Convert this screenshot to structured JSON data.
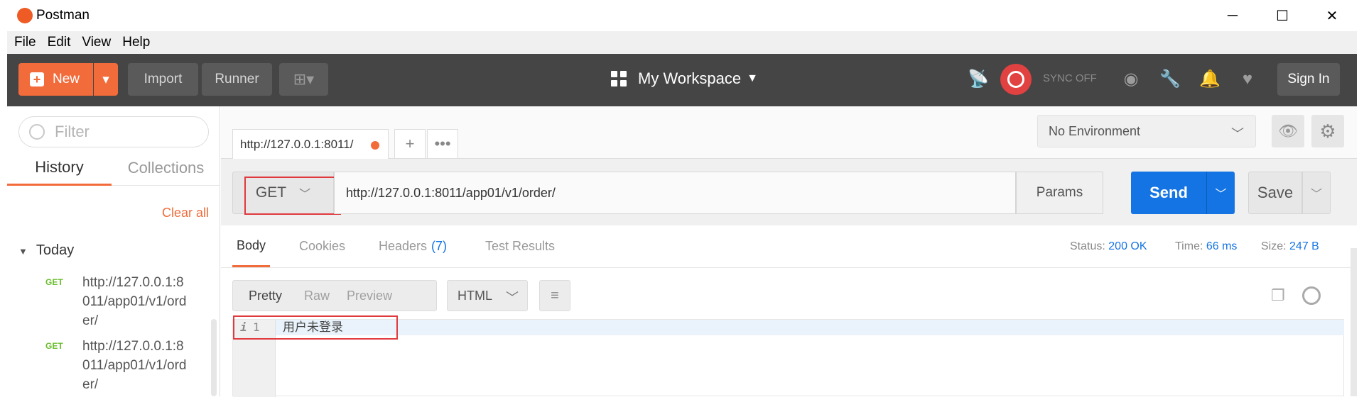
{
  "window": {
    "title": "Postman",
    "minimize": "─",
    "maximize": "☐",
    "close": "✕"
  },
  "menu": [
    "File",
    "Edit",
    "View",
    "Help"
  ],
  "toolbar": {
    "new_label": "New",
    "import_label": "Import",
    "runner_label": "Runner",
    "workspace_label": "My Workspace",
    "sync_label": "SYNC OFF",
    "signin_label": "Sign In"
  },
  "sidebar": {
    "filter_placeholder": "Filter",
    "tabs": [
      "History",
      "Collections"
    ],
    "clear_all": "Clear all",
    "group": "Today",
    "items": [
      {
        "method": "GET",
        "url": "http://127.0.0.1:8011/app01/v1/order/"
      },
      {
        "method": "GET",
        "url": "http://127.0.0.1:8011/app01/v1/order/"
      }
    ]
  },
  "request": {
    "tab_label": "http://127.0.0.1:8011/",
    "add_tab": "+",
    "more_tabs": "•••",
    "environment": "No Environment",
    "method": "GET",
    "url": "http://127.0.0.1:8011/app01/v1/order/",
    "params_label": "Params",
    "send_label": "Send",
    "save_label": "Save"
  },
  "response": {
    "tabs": {
      "body": "Body",
      "cookies": "Cookies",
      "headers": "Headers",
      "headers_count": "(7)",
      "tests": "Test Results"
    },
    "status_label": "Status:",
    "status_value": "200 OK",
    "time_label": "Time:",
    "time_value": "66 ms",
    "size_label": "Size:",
    "size_value": "247 B",
    "formats": [
      "Pretty",
      "Raw",
      "Preview"
    ],
    "language": "HTML",
    "line_number": "1",
    "line_text": "用户未登录"
  }
}
